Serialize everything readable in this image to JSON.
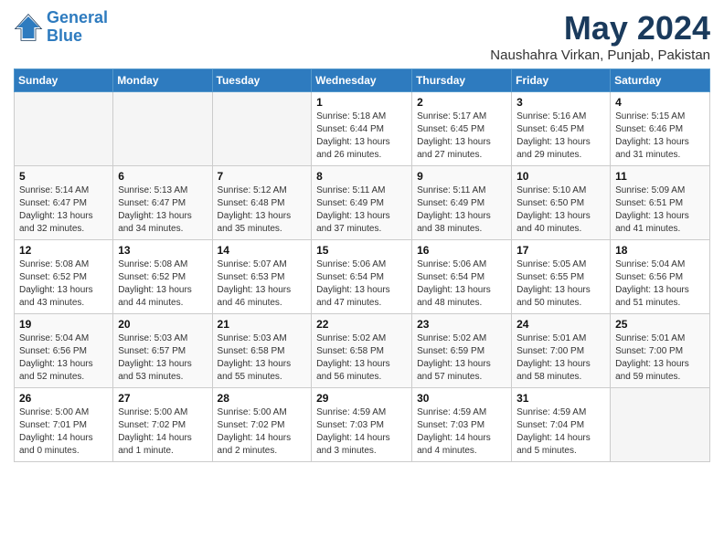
{
  "header": {
    "logo_line1": "General",
    "logo_line2": "Blue",
    "month": "May 2024",
    "location": "Naushahra Virkan, Punjab, Pakistan"
  },
  "weekdays": [
    "Sunday",
    "Monday",
    "Tuesday",
    "Wednesday",
    "Thursday",
    "Friday",
    "Saturday"
  ],
  "weeks": [
    [
      {
        "day": "",
        "info": ""
      },
      {
        "day": "",
        "info": ""
      },
      {
        "day": "",
        "info": ""
      },
      {
        "day": "1",
        "info": "Sunrise: 5:18 AM\nSunset: 6:44 PM\nDaylight: 13 hours\nand 26 minutes."
      },
      {
        "day": "2",
        "info": "Sunrise: 5:17 AM\nSunset: 6:45 PM\nDaylight: 13 hours\nand 27 minutes."
      },
      {
        "day": "3",
        "info": "Sunrise: 5:16 AM\nSunset: 6:45 PM\nDaylight: 13 hours\nand 29 minutes."
      },
      {
        "day": "4",
        "info": "Sunrise: 5:15 AM\nSunset: 6:46 PM\nDaylight: 13 hours\nand 31 minutes."
      }
    ],
    [
      {
        "day": "5",
        "info": "Sunrise: 5:14 AM\nSunset: 6:47 PM\nDaylight: 13 hours\nand 32 minutes."
      },
      {
        "day": "6",
        "info": "Sunrise: 5:13 AM\nSunset: 6:47 PM\nDaylight: 13 hours\nand 34 minutes."
      },
      {
        "day": "7",
        "info": "Sunrise: 5:12 AM\nSunset: 6:48 PM\nDaylight: 13 hours\nand 35 minutes."
      },
      {
        "day": "8",
        "info": "Sunrise: 5:11 AM\nSunset: 6:49 PM\nDaylight: 13 hours\nand 37 minutes."
      },
      {
        "day": "9",
        "info": "Sunrise: 5:11 AM\nSunset: 6:49 PM\nDaylight: 13 hours\nand 38 minutes."
      },
      {
        "day": "10",
        "info": "Sunrise: 5:10 AM\nSunset: 6:50 PM\nDaylight: 13 hours\nand 40 minutes."
      },
      {
        "day": "11",
        "info": "Sunrise: 5:09 AM\nSunset: 6:51 PM\nDaylight: 13 hours\nand 41 minutes."
      }
    ],
    [
      {
        "day": "12",
        "info": "Sunrise: 5:08 AM\nSunset: 6:52 PM\nDaylight: 13 hours\nand 43 minutes."
      },
      {
        "day": "13",
        "info": "Sunrise: 5:08 AM\nSunset: 6:52 PM\nDaylight: 13 hours\nand 44 minutes."
      },
      {
        "day": "14",
        "info": "Sunrise: 5:07 AM\nSunset: 6:53 PM\nDaylight: 13 hours\nand 46 minutes."
      },
      {
        "day": "15",
        "info": "Sunrise: 5:06 AM\nSunset: 6:54 PM\nDaylight: 13 hours\nand 47 minutes."
      },
      {
        "day": "16",
        "info": "Sunrise: 5:06 AM\nSunset: 6:54 PM\nDaylight: 13 hours\nand 48 minutes."
      },
      {
        "day": "17",
        "info": "Sunrise: 5:05 AM\nSunset: 6:55 PM\nDaylight: 13 hours\nand 50 minutes."
      },
      {
        "day": "18",
        "info": "Sunrise: 5:04 AM\nSunset: 6:56 PM\nDaylight: 13 hours\nand 51 minutes."
      }
    ],
    [
      {
        "day": "19",
        "info": "Sunrise: 5:04 AM\nSunset: 6:56 PM\nDaylight: 13 hours\nand 52 minutes."
      },
      {
        "day": "20",
        "info": "Sunrise: 5:03 AM\nSunset: 6:57 PM\nDaylight: 13 hours\nand 53 minutes."
      },
      {
        "day": "21",
        "info": "Sunrise: 5:03 AM\nSunset: 6:58 PM\nDaylight: 13 hours\nand 55 minutes."
      },
      {
        "day": "22",
        "info": "Sunrise: 5:02 AM\nSunset: 6:58 PM\nDaylight: 13 hours\nand 56 minutes."
      },
      {
        "day": "23",
        "info": "Sunrise: 5:02 AM\nSunset: 6:59 PM\nDaylight: 13 hours\nand 57 minutes."
      },
      {
        "day": "24",
        "info": "Sunrise: 5:01 AM\nSunset: 7:00 PM\nDaylight: 13 hours\nand 58 minutes."
      },
      {
        "day": "25",
        "info": "Sunrise: 5:01 AM\nSunset: 7:00 PM\nDaylight: 13 hours\nand 59 minutes."
      }
    ],
    [
      {
        "day": "26",
        "info": "Sunrise: 5:00 AM\nSunset: 7:01 PM\nDaylight: 14 hours\nand 0 minutes."
      },
      {
        "day": "27",
        "info": "Sunrise: 5:00 AM\nSunset: 7:02 PM\nDaylight: 14 hours\nand 1 minute."
      },
      {
        "day": "28",
        "info": "Sunrise: 5:00 AM\nSunset: 7:02 PM\nDaylight: 14 hours\nand 2 minutes."
      },
      {
        "day": "29",
        "info": "Sunrise: 4:59 AM\nSunset: 7:03 PM\nDaylight: 14 hours\nand 3 minutes."
      },
      {
        "day": "30",
        "info": "Sunrise: 4:59 AM\nSunset: 7:03 PM\nDaylight: 14 hours\nand 4 minutes."
      },
      {
        "day": "31",
        "info": "Sunrise: 4:59 AM\nSunset: 7:04 PM\nDaylight: 14 hours\nand 5 minutes."
      },
      {
        "day": "",
        "info": ""
      }
    ]
  ]
}
